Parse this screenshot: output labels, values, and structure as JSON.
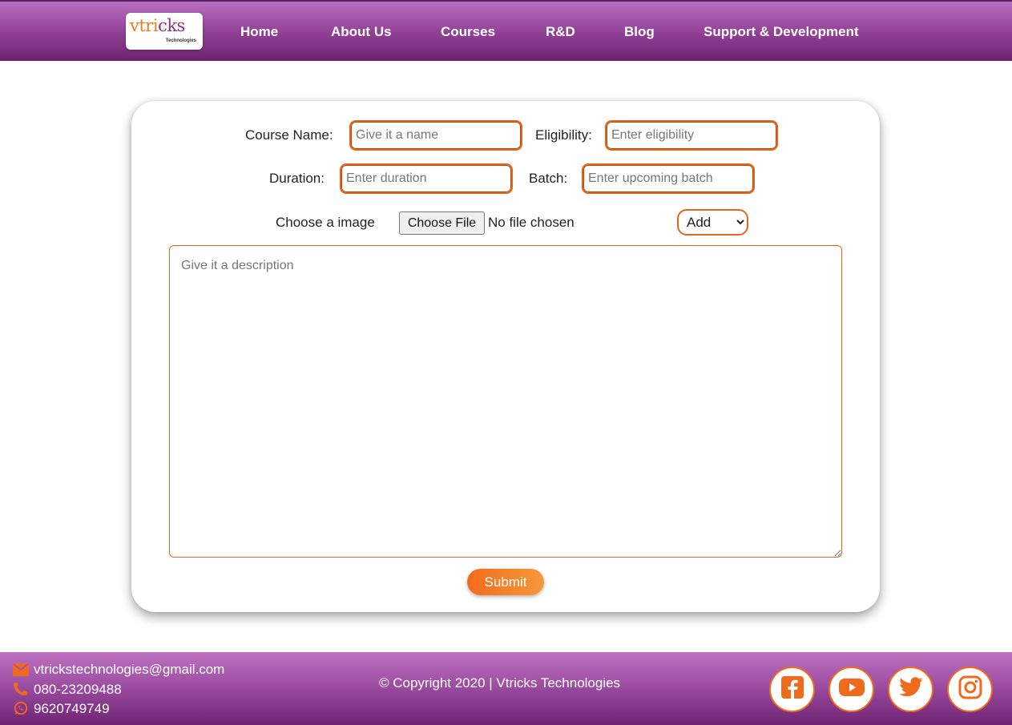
{
  "header": {
    "logo_text_a": "vtri",
    "logo_text_b": "cks",
    "logo_sub": "Technologies",
    "nav": [
      {
        "label": "Home"
      },
      {
        "label": "About Us"
      },
      {
        "label": "Courses"
      },
      {
        "label": "R&D"
      },
      {
        "label": "Blog"
      },
      {
        "label": "Support & Development"
      }
    ]
  },
  "form": {
    "course_name_label": "Course Name:",
    "course_name_placeholder": "Give it a name",
    "eligibility_label": "Eligibility:",
    "eligibility_placeholder": "Enter eligibility",
    "duration_label": "Duration:",
    "duration_placeholder": "Enter duration",
    "batch_label": "Batch:",
    "batch_placeholder": "Enter upcoming batch",
    "image_label": "Choose a image",
    "file_button": "Choose File",
    "file_status": "No file chosen",
    "action_select_value": "Add",
    "description_placeholder": "Give it a description",
    "submit_label": "Submit"
  },
  "footer": {
    "email": "vtrickstechnologies@gmail.com",
    "phone": "080-23209488",
    "whatsapp": "9620749749",
    "copyright": "© Copyright 2020 | Vtricks Technologies"
  },
  "colors": {
    "header_purple": "#8f3f93",
    "accent_orange": "#f07a1e"
  },
  "icons": [
    "email-icon",
    "phone-icon",
    "whatsapp-icon",
    "facebook-icon",
    "youtube-icon",
    "twitter-icon",
    "instagram-icon"
  ]
}
